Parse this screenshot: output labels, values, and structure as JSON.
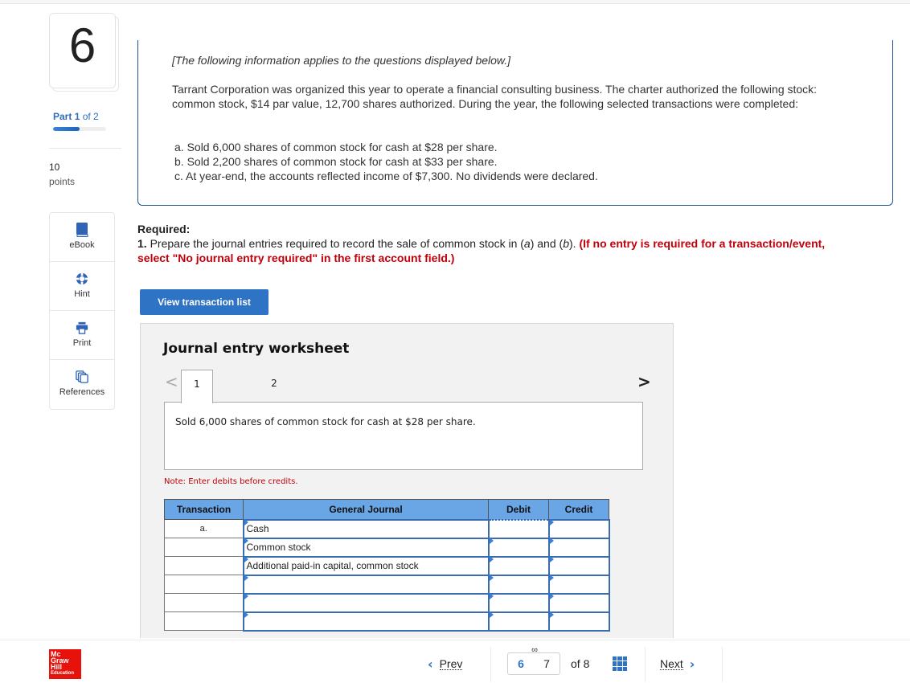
{
  "question": {
    "number": "6",
    "part_label": "Part",
    "part_current": "1",
    "part_of": "of 2",
    "part_progress": 0.5,
    "points_value": "10",
    "points_label": "points"
  },
  "tools": [
    {
      "label": "eBook",
      "icon": "book-icon"
    },
    {
      "label": "Hint",
      "icon": "lifebuoy-icon"
    },
    {
      "label": "Print",
      "icon": "printer-icon"
    },
    {
      "label": "References",
      "icon": "documents-icon"
    }
  ],
  "info": {
    "intro": "[The following information applies to the questions displayed below.]",
    "paragraph": "Tarrant Corporation was organized this year to operate a financial consulting business. The charter authorized the following stock: common stock, $14 par value, 12,700 shares authorized. During the year, the following selected transactions were completed:",
    "items": [
      "a. Sold 6,000 shares of common stock for cash at $28 per share.",
      "b. Sold 2,200 shares of common stock for cash at $33 per share.",
      "c. At year-end, the accounts reflected income of $7,300. No dividends were declared."
    ]
  },
  "required": {
    "title": "Required:",
    "num": "1.",
    "text_before": " Prepare the journal entries required to record the sale of common stock in (",
    "a": "a",
    "mid": ") and (",
    "b": "b",
    "text_after": "). ",
    "red": "(If no entry is required for a transaction/event, select \"No journal entry required\" in the first account field.)"
  },
  "view_transaction_list_label": "View transaction list",
  "worksheet": {
    "title": "Journal entry worksheet",
    "prev_glyph": "<",
    "next_glyph": ">",
    "tabs": [
      "1",
      "2"
    ],
    "active_tab": "1",
    "description": "Sold 6,000 shares of common stock for cash at $28 per share.",
    "note": "Note: Enter debits before credits.",
    "columns": [
      "Transaction",
      "General Journal",
      "Debit",
      "Credit"
    ],
    "rows": [
      {
        "transaction": "a.",
        "account": "Cash",
        "debit": "",
        "credit": ""
      },
      {
        "transaction": "",
        "account": "Common stock",
        "debit": "",
        "credit": ""
      },
      {
        "transaction": "",
        "account": "Additional paid-in capital, common stock",
        "debit": "",
        "credit": ""
      },
      {
        "transaction": "",
        "account": "",
        "debit": "",
        "credit": ""
      },
      {
        "transaction": "",
        "account": "",
        "debit": "",
        "credit": ""
      },
      {
        "transaction": "",
        "account": "",
        "debit": "",
        "credit": ""
      }
    ]
  },
  "footer": {
    "logo_lines": [
      "Mc",
      "Graw",
      "Hill",
      "Education"
    ],
    "prev_label": "Prev",
    "current_page": "6",
    "next_page_input": "7",
    "of_label": "of 8",
    "next_label": "Next"
  },
  "colors": {
    "accent_blue": "#2e73c4",
    "header_blue": "#6aa5e6",
    "required_red": "#c0000a",
    "logo_red": "#e8120c"
  }
}
